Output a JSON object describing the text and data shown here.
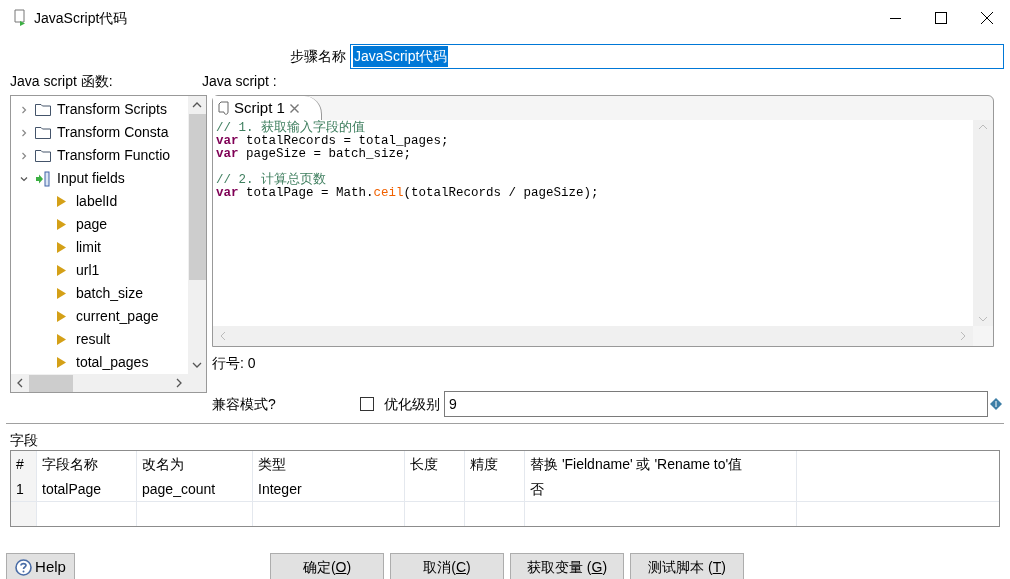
{
  "window": {
    "title": "JavaScript代码"
  },
  "step_name": {
    "label": "步骤名称",
    "value": "JavaScript代码",
    "selected": true
  },
  "functions_panel": {
    "label": "Java script 函数:",
    "tree": [
      {
        "label": "Transform Scripts",
        "kind": "folder",
        "expanded": false
      },
      {
        "label": "Transform Consta",
        "kind": "folder",
        "expanded": false
      },
      {
        "label": "Transform Functio",
        "kind": "folder",
        "expanded": false
      },
      {
        "label": "Input fields",
        "kind": "input",
        "expanded": true,
        "children": [
          {
            "label": "labelId",
            "kind": "field"
          },
          {
            "label": "page",
            "kind": "field"
          },
          {
            "label": "limit",
            "kind": "field"
          },
          {
            "label": "url1",
            "kind": "field"
          },
          {
            "label": "batch_size",
            "kind": "field"
          },
          {
            "label": "current_page",
            "kind": "field"
          },
          {
            "label": "result",
            "kind": "field"
          },
          {
            "label": "total_pages",
            "kind": "field"
          }
        ]
      }
    ]
  },
  "script_panel": {
    "label": "Java script :",
    "tabs": [
      {
        "label": "Script 1",
        "selected": true
      }
    ],
    "code_blocks": [
      [
        [
          {
            "kind": "comment",
            "text": "// 1. 获取输入字段的值"
          }
        ],
        [
          {
            "kind": "keyword",
            "text": "var"
          },
          {
            "kind": "plain",
            "text": " totalRecords = total_pages;"
          }
        ],
        [
          {
            "kind": "keyword",
            "text": "var"
          },
          {
            "kind": "plain",
            "text": " pageSize = batch_size;"
          }
        ]
      ],
      [
        [
          {
            "kind": "comment",
            "text": "// 2. 计算总页数"
          }
        ],
        [
          {
            "kind": "keyword",
            "text": "var"
          },
          {
            "kind": "plain",
            "text": " totalPage = Math."
          },
          {
            "kind": "method",
            "text": "ceil"
          },
          {
            "kind": "plain",
            "text": "(totalRecords / pageSize);"
          }
        ]
      ]
    ]
  },
  "line_number": "行号: 0",
  "compat_mode": {
    "label": "兼容模式?",
    "checked": false
  },
  "optimization": {
    "label": "优化级别",
    "value": "9"
  },
  "fields": {
    "label": "字段",
    "columns": [
      "#",
      "字段名称",
      "改名为",
      "类型",
      "长度",
      "精度",
      "替换 'Fieldname' 或 'Rename to'值"
    ],
    "rows": [
      [
        "1",
        "totalPage",
        "page_count",
        "Integer",
        "",
        "",
        "否"
      ]
    ]
  },
  "help_button": "Help",
  "buttons": [
    {
      "before": "确定(",
      "key": "O",
      "after": ")"
    },
    {
      "before": "取消(",
      "key": "C",
      "after": ")"
    },
    {
      "before": "获取变量 (",
      "key": "G",
      "after": ")"
    },
    {
      "before": "测试脚本 (",
      "key": "T",
      "after": ")"
    }
  ]
}
